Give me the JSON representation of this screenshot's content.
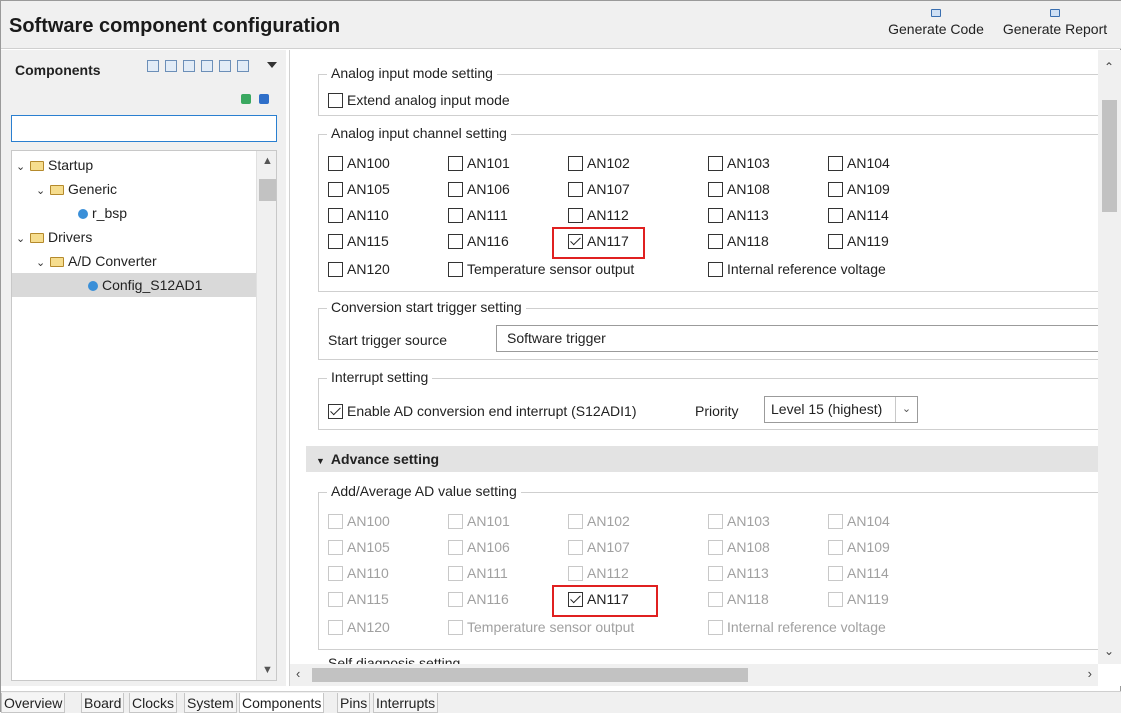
{
  "header": {
    "title": "Software component configuration",
    "generate_code": "Generate Code",
    "generate_report": "Generate Report"
  },
  "left": {
    "title": "Components",
    "search_value": "",
    "tree": [
      {
        "label": "Startup",
        "icon": "folder-icon"
      },
      {
        "label": "Generic",
        "icon": "folder-icon"
      },
      {
        "label": "r_bsp",
        "icon": "component-icon"
      },
      {
        "label": "Drivers",
        "icon": "folder-icon"
      },
      {
        "label": "A/D Converter",
        "icon": "folder-icon"
      },
      {
        "label": "Config_S12AD1",
        "icon": "component-icon"
      }
    ]
  },
  "analog_mode": {
    "legend": "Analog input mode setting",
    "extend": "Extend analog input mode"
  },
  "channels": {
    "legend": "Analog input channel setting",
    "rows": [
      [
        "AN100",
        "AN101",
        "AN102",
        "AN103",
        "AN104"
      ],
      [
        "AN105",
        "AN106",
        "AN107",
        "AN108",
        "AN109"
      ],
      [
        "AN110",
        "AN111",
        "AN112",
        "AN113",
        "AN114"
      ],
      [
        "AN115",
        "AN116",
        "AN117",
        "AN118",
        "AN119"
      ]
    ],
    "an120": "AN120",
    "temp": "Temperature sensor output",
    "internal": "Internal reference voltage"
  },
  "trigger": {
    "legend": "Conversion start trigger setting",
    "label": "Start trigger source",
    "value": "Software trigger"
  },
  "interrupt": {
    "legend": "Interrupt setting",
    "enable": "Enable AD conversion end interrupt (S12ADI1)",
    "priority_label": "Priority",
    "priority_value": "Level 15 (highest)"
  },
  "advance": {
    "title": "Advance setting",
    "legend": "Add/Average AD value setting",
    "rows": [
      [
        "AN100",
        "AN101",
        "AN102",
        "AN103",
        "AN104"
      ],
      [
        "AN105",
        "AN106",
        "AN107",
        "AN108",
        "AN109"
      ],
      [
        "AN110",
        "AN111",
        "AN112",
        "AN113",
        "AN114"
      ],
      [
        "AN115",
        "AN116",
        "AN117",
        "AN118",
        "AN119"
      ]
    ],
    "an120": "AN120",
    "temp": "Temperature sensor output",
    "internal": "Internal reference voltage",
    "next_legend": "Self diagnosis setting"
  },
  "tabs": [
    "Overview",
    "Board",
    "Clocks",
    "System",
    "Components",
    "Pins",
    "Interrupts"
  ]
}
